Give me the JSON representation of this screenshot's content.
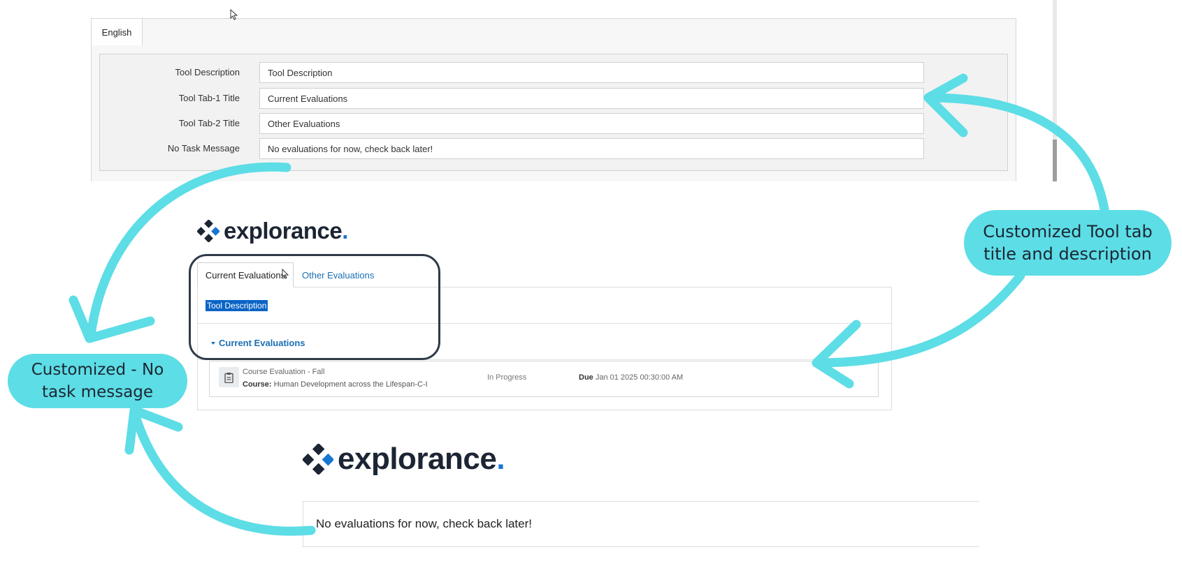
{
  "settings": {
    "language_tab": "English",
    "fields": [
      {
        "label": "Tool Description",
        "value": "Tool Description"
      },
      {
        "label": "Tool Tab-1 Title",
        "value": "Current Evaluations"
      },
      {
        "label": "Tool Tab-2 Title",
        "value": "Other Evaluations"
      },
      {
        "label": "No Task Message",
        "value": "No evaluations for now, check back later!"
      }
    ]
  },
  "logo": {
    "text": "explorance",
    "dot": "."
  },
  "preview": {
    "tabs": [
      "Current Evaluations",
      "Other Evaluations"
    ],
    "description": "Tool Description",
    "section_title": "Current Evaluations",
    "evaluation": {
      "title": "Course Evaluation - Fall",
      "course_label": "Course:",
      "course_name": "Human Development across the Lifespan-C-I",
      "status": "In Progress",
      "due_label": "Due",
      "due_date": "Jan 01 2025 00:30:00 AM"
    }
  },
  "no_task_preview": {
    "message": "No evaluations for now, check back later!"
  },
  "callouts": {
    "right": "Customized Tool tab title and description",
    "left": "Customized - No task message"
  },
  "colors": {
    "callout": "#5ddde6",
    "link": "#1a6fb5",
    "highlight": "#0a64c6",
    "logo_dot": "#1676d2"
  },
  "icons": [
    "mouse-cursor-icon",
    "explorance-logo-icon",
    "clipboard-icon",
    "caret-down-icon"
  ]
}
